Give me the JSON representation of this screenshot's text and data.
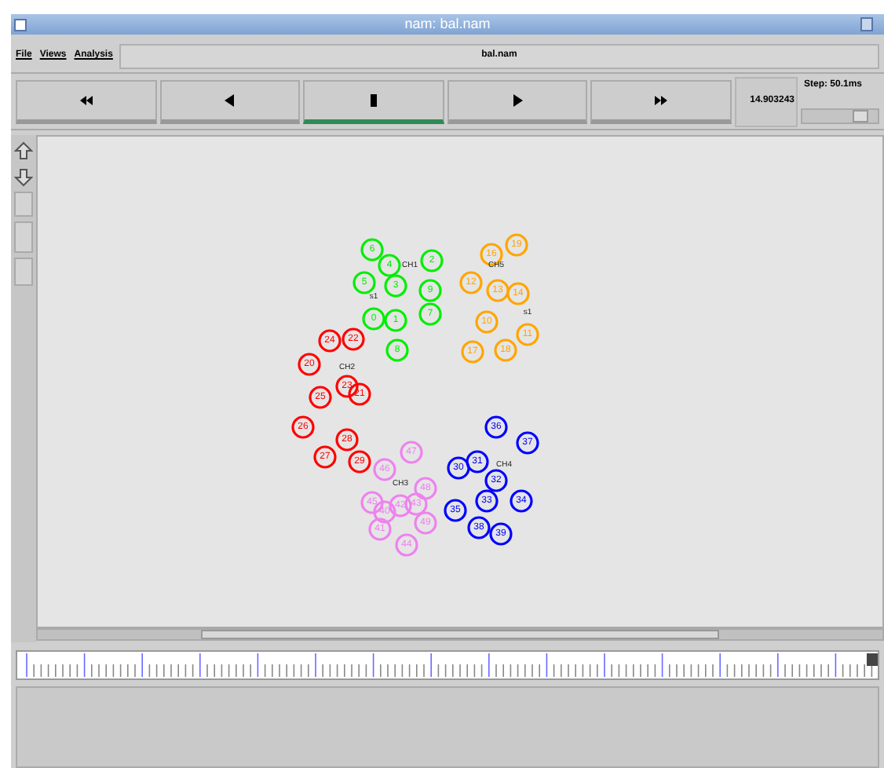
{
  "window": {
    "title": "nam: bal.nam"
  },
  "menu": [
    "File",
    "Views",
    "Analysis"
  ],
  "file_label": "bal.nam",
  "transport": [
    {
      "kind": "rewind",
      "selected": false
    },
    {
      "kind": "back",
      "selected": false
    },
    {
      "kind": "stop",
      "selected": true
    },
    {
      "kind": "play",
      "selected": false
    },
    {
      "kind": "forward",
      "selected": false
    }
  ],
  "time": "14.903243",
  "step": {
    "label": "Step: 50.1ms",
    "level": 0.85
  },
  "clusters": [
    {
      "label": "CH1",
      "tag": "s1",
      "color": "#00ee00",
      "nodes": [
        "6",
        "4",
        "2",
        "5",
        "3",
        "9",
        "0",
        "1",
        "7",
        "8"
      ]
    },
    {
      "label": "CH5",
      "tag": "s1",
      "color": "#ffa500",
      "nodes": [
        "16",
        "19",
        "12",
        "13",
        "14",
        "10",
        "11",
        "17",
        "18"
      ]
    },
    {
      "label": "CH2",
      "color": "#ff0000",
      "nodes": [
        "24",
        "22",
        "20",
        "23",
        "21",
        "25",
        "26",
        "27",
        "28",
        "29"
      ]
    },
    {
      "label": "CH4",
      "color": "#0000ff",
      "nodes": [
        "36",
        "37",
        "30",
        "31",
        "32",
        "33",
        "35",
        "34",
        "38",
        "39"
      ]
    },
    {
      "label": "CH3",
      "color": "#ee82ee",
      "nodes": [
        "47",
        "46",
        "45",
        "40",
        "42",
        "43",
        "48",
        "41",
        "49",
        "44"
      ]
    }
  ]
}
